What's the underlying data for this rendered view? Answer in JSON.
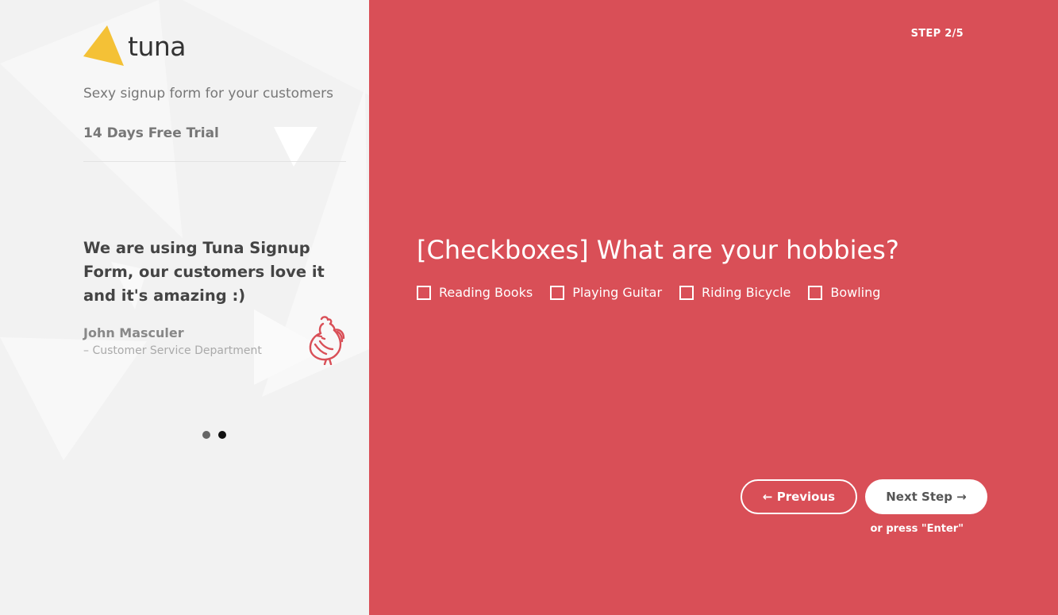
{
  "brand": {
    "name": "tuna",
    "accent_color": "#f4c136"
  },
  "sidebar": {
    "tagline": "Sexy signup form for your customers",
    "trial": "14 Days Free Trial",
    "testimonial": {
      "quote": "We are using Tuna Signup Form, our customers love it and it's amazing :)",
      "author": "John Masculer",
      "department": "– Customer Service Department",
      "logo_icon": "rooster-icon"
    },
    "carousel": {
      "count": 2,
      "active": 2
    }
  },
  "form": {
    "background_color": "#d94f57",
    "step": "STEP 2/5",
    "question": "[Checkboxes] What are your hobbies?",
    "options": [
      {
        "label": "Reading Books",
        "checked": false
      },
      {
        "label": "Playing Guitar",
        "checked": false
      },
      {
        "label": "Riding Bicycle",
        "checked": false
      },
      {
        "label": "Bowling",
        "checked": false
      }
    ],
    "previous_label": "← Previous",
    "next_label": "Next Step →",
    "hint": "or press \"Enter\""
  }
}
